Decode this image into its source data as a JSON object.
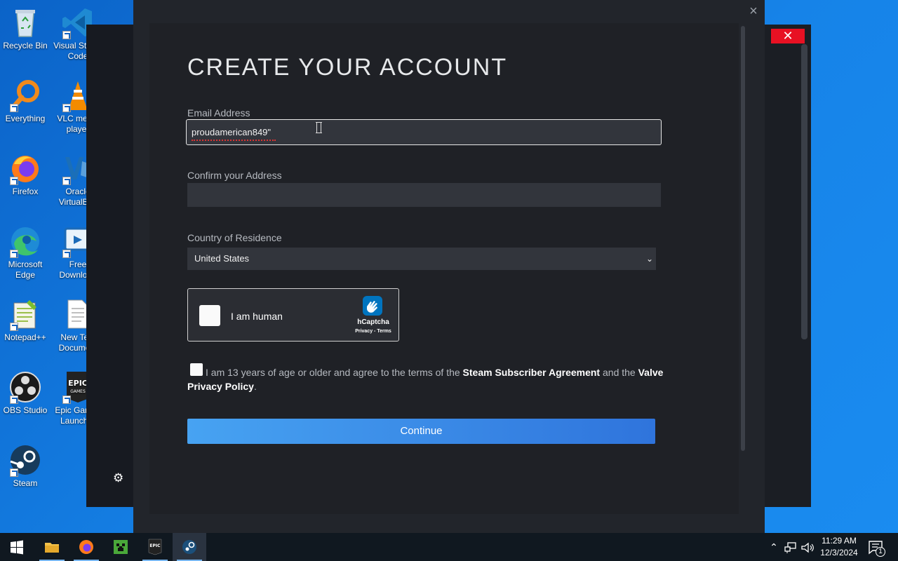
{
  "desktop": {
    "icons": [
      {
        "id": "recycle-bin",
        "label": "Recycle Bin"
      },
      {
        "id": "vscode",
        "label": "Visual Studio Code"
      },
      {
        "id": "everything",
        "label": "Everything"
      },
      {
        "id": "vlc",
        "label": "VLC media player"
      },
      {
        "id": "firefox",
        "label": "Firefox"
      },
      {
        "id": "oracle-vm",
        "label": "Oracle VirtualBox"
      },
      {
        "id": "edge",
        "label": "Microsoft Edge"
      },
      {
        "id": "free-download",
        "label": "Free Download"
      },
      {
        "id": "notepadpp",
        "label": "Notepad++"
      },
      {
        "id": "new-text-doc",
        "label": "New Text Document"
      },
      {
        "id": "obs",
        "label": "OBS Studio"
      },
      {
        "id": "epic",
        "label": "Epic Games Launcher"
      },
      {
        "id": "steam",
        "label": "Steam"
      }
    ]
  },
  "dialog": {
    "title": "CREATE YOUR ACCOUNT",
    "email": {
      "label": "Email Address",
      "value": "proudamerican849\""
    },
    "confirm": {
      "label": "Confirm your Address",
      "value": ""
    },
    "country": {
      "label": "Country of Residence",
      "selected": "United States"
    },
    "captcha": {
      "text": "I am human",
      "brand": "hCaptcha",
      "links": "Privacy - Terms"
    },
    "agreement": {
      "prefix": "I am 13 years of age or older and agree to the terms of the ",
      "link1": "Steam Subscriber Agreement",
      "middle": " and the ",
      "link2": "Valve Privacy Policy",
      "suffix": "."
    },
    "continue_label": "Continue",
    "close_glyph": "×"
  },
  "background_window": {
    "close_glyph": "✕",
    "gear_glyph": "⚙"
  },
  "taskbar": {
    "apps": [
      {
        "id": "start",
        "icon": "windows-icon"
      },
      {
        "id": "file-explorer",
        "icon": "folder-icon"
      },
      {
        "id": "firefox",
        "icon": "firefox-icon"
      },
      {
        "id": "minecraft",
        "icon": "minecraft-icon"
      },
      {
        "id": "epic",
        "icon": "epic-games-icon"
      },
      {
        "id": "steam",
        "icon": "steam-icon"
      }
    ],
    "time": "11:29 AM",
    "date": "12/3/2024",
    "notifications": "1"
  },
  "colors": {
    "accent_blue": "#2f74dc",
    "dialog_bg": "#22252b",
    "field_bg": "#32353c",
    "close_red": "#e81123"
  }
}
